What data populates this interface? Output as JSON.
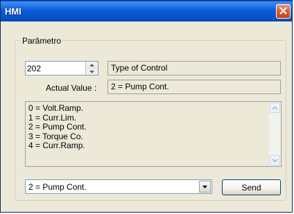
{
  "window": {
    "title": "HMI",
    "close_icon": "close-icon"
  },
  "group": {
    "label": "Parâmetro"
  },
  "parameter": {
    "number": "202",
    "description": "Type of Control"
  },
  "actual": {
    "label": "Actual Value :",
    "value": "2 = Pump Cont."
  },
  "options": {
    "items": [
      "0 = Volt.Ramp.",
      "1 = Curr.Lim.",
      "2 = Pump Cont.",
      "3 = Torque Co.",
      "4 = Curr.Ramp."
    ]
  },
  "selector": {
    "value": "2 = Pump Cont."
  },
  "send": {
    "label": "Send"
  }
}
